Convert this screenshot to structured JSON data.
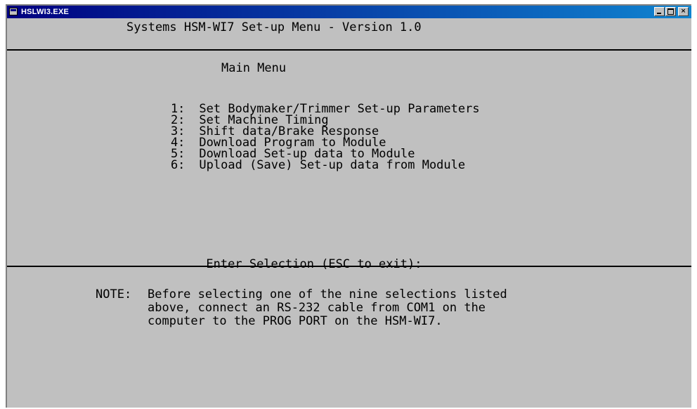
{
  "window": {
    "title": "HSLWI3.EXE",
    "minimize_label": "_",
    "maximize_label": "",
    "close_label": "×"
  },
  "header": {
    "title": "Systems HSM-WI7 Set-up Menu - Version 1.0"
  },
  "menu": {
    "heading": "Main Menu",
    "items": [
      {
        "number": "1:",
        "label": "Set Bodymaker/Trimmer Set-up Parameters"
      },
      {
        "number": "2:",
        "label": "Set Machine Timing"
      },
      {
        "number": "3:",
        "label": "Shift data/Brake Response"
      },
      {
        "number": "4:",
        "label": "Download Program to Module"
      },
      {
        "number": "5:",
        "label": "Download Set-up data to Module"
      },
      {
        "number": "6:",
        "label": "Upload (Save) Set-up data from Module"
      }
    ],
    "prompt": "Enter Selection (ESC to exit):"
  },
  "note": {
    "prefix": "NOTE:",
    "lines": [
      "Before selecting one of the nine selections listed",
      "above, connect an RS-232 cable from COM1 on the",
      "computer to the PROG PORT on the HSM-WI7."
    ]
  }
}
